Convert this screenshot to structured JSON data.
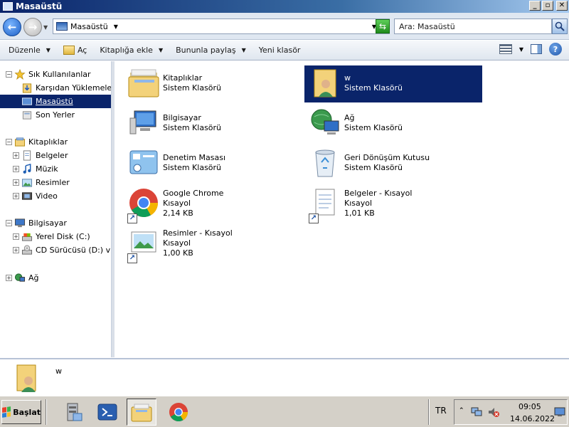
{
  "window": {
    "title": "Masaüstü",
    "buttons": {
      "minimize": "_",
      "maximize": "▫",
      "close": "✕"
    }
  },
  "address": {
    "location": "Masaüstü",
    "search_placeholder": "Ara: Masaüstü"
  },
  "toolbar": {
    "organize": "Düzenle",
    "open": "Aç",
    "add_to_library": "Kitaplığa ekle",
    "share_with": "Bununla paylaş",
    "new_folder": "Yeni klasör"
  },
  "navigation": {
    "favorites": "Sık Kullanılanlar",
    "downloads": "Karşıdan Yüklemeler",
    "desktop": "Masaüstü",
    "recent": "Son Yerler",
    "libraries": "Kitaplıklar",
    "documents": "Belgeler",
    "music": "Müzik",
    "pictures": "Resimler",
    "video": "Video",
    "computer": "Bilgisayar",
    "local_disk": "Yerel Disk (C:)",
    "cd_drive": "CD Sürücüsü (D:) virtio",
    "network": "Ağ"
  },
  "items": [
    {
      "name": "Kitaplıklar",
      "type": "Sistem Klasörü",
      "size": ""
    },
    {
      "name": "w",
      "type": "Sistem Klasörü",
      "size": ""
    },
    {
      "name": "Bilgisayar",
      "type": "Sistem Klasörü",
      "size": ""
    },
    {
      "name": "Ağ",
      "type": "Sistem Klasörü",
      "size": ""
    },
    {
      "name": "Denetim Masası",
      "type": "Sistem Klasörü",
      "size": ""
    },
    {
      "name": "Geri Dönüşüm Kutusu",
      "type": "Sistem Klasörü",
      "size": ""
    },
    {
      "name": "Google Chrome",
      "type": "Kısayol",
      "size": "2,14 KB"
    },
    {
      "name": "Belgeler - Kısayol",
      "type": "Kısayol",
      "size": "1,01 KB"
    },
    {
      "name": "Resimler - Kısayol",
      "type": "Kısayol",
      "size": "1,00 KB"
    }
  ],
  "details": {
    "name": "w"
  },
  "taskbar": {
    "start": "Başlat",
    "language": "TR",
    "time": "09:05",
    "date": "14.06.2022"
  },
  "colors": {
    "selection": "#0a246a",
    "title_start": "#0a246a",
    "taskbar": "#d4d0c8"
  }
}
